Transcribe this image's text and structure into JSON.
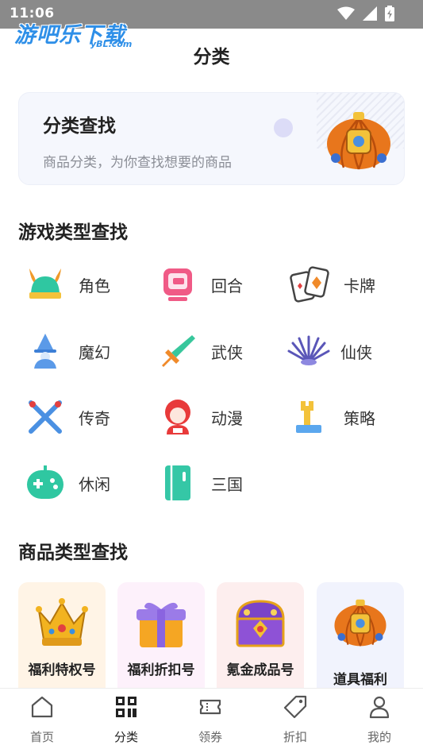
{
  "status": {
    "time": "11:06"
  },
  "watermark": {
    "text": "游吧乐下载",
    "sub": "yBL.com"
  },
  "page": {
    "title": "分类"
  },
  "banner": {
    "title": "分类查找",
    "subtitle": "商品分类，为你查找想要的商品",
    "image_icon": "pumpkin-carriage-icon"
  },
  "game_section": {
    "title": "游戏类型查找",
    "items": [
      {
        "label": "角色",
        "icon": "viking-helmet-icon"
      },
      {
        "label": "回合",
        "icon": "arcade-icon"
      },
      {
        "label": "卡牌",
        "icon": "playing-cards-icon"
      },
      {
        "label": "魔幻",
        "icon": "wizard-icon"
      },
      {
        "label": "武侠",
        "icon": "sword-icon"
      },
      {
        "label": "仙侠",
        "icon": "folding-fan-icon"
      },
      {
        "label": "传奇",
        "icon": "crossed-swords-icon"
      },
      {
        "label": "动漫",
        "icon": "anime-girl-icon"
      },
      {
        "label": "策略",
        "icon": "chess-rook-icon"
      },
      {
        "label": "休闲",
        "icon": "gamepad-icon"
      },
      {
        "label": "三国",
        "icon": "book-icon"
      }
    ]
  },
  "goods_section": {
    "title": "商品类型查找",
    "cards": [
      {
        "label": "福利特权号",
        "icon": "crown-icon",
        "bg": "#fff4e6"
      },
      {
        "label": "福利折扣号",
        "icon": "gift-box-icon",
        "bg": "#fdf1fb"
      },
      {
        "label": "氪金成品号",
        "icon": "treasure-chest-icon",
        "bg": "#fdeeee"
      },
      {
        "label": "道具福利",
        "icon": "pumpkin-carriage-icon",
        "bg": "#f1f3fd"
      }
    ]
  },
  "tabbar": {
    "tabs": [
      {
        "label": "首页",
        "icon": "home-icon"
      },
      {
        "label": "分类",
        "icon": "category-icon",
        "active": true
      },
      {
        "label": "领券",
        "icon": "ticket-icon"
      },
      {
        "label": "折扣",
        "icon": "tag-icon"
      },
      {
        "label": "我的",
        "icon": "user-icon"
      }
    ]
  },
  "colors": {
    "accent": "#2e8fe8",
    "card_bg": "#f5f7fd"
  }
}
